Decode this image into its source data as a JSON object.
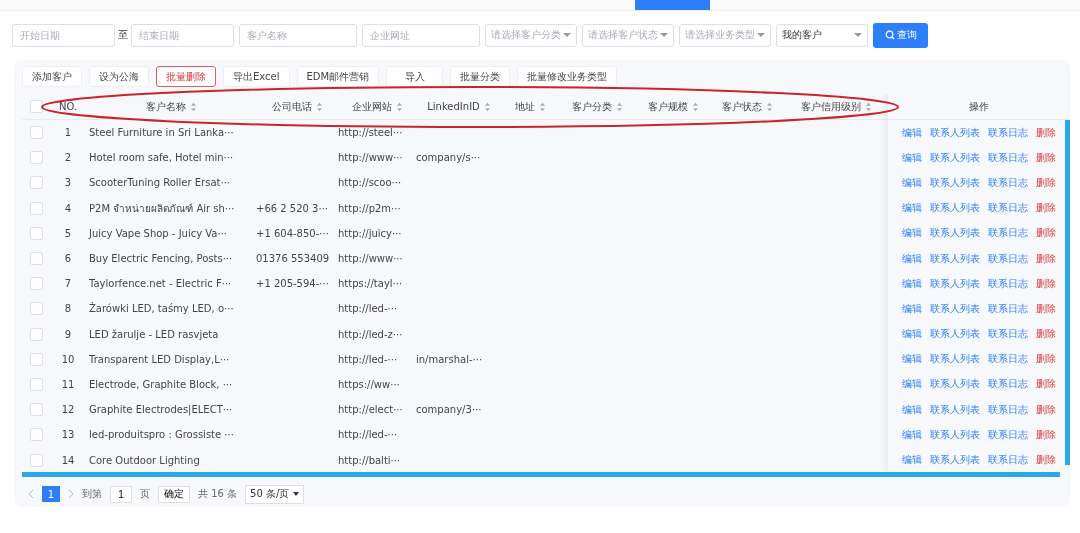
{
  "filters": {
    "start_date": {
      "placeholder": "开始日期"
    },
    "to_label": "至",
    "end_date": {
      "placeholder": "结束日期"
    },
    "customer_name": {
      "placeholder": "客户名称"
    },
    "website": {
      "placeholder": "企业网址"
    },
    "selects": [
      {
        "placeholder": "请选择客户分类"
      },
      {
        "placeholder": "请选择客户状态"
      },
      {
        "placeholder": "请选择业务类型"
      },
      {
        "value": "我的客户"
      }
    ],
    "search_button": "查询"
  },
  "toolbar": [
    {
      "label": "添加客户",
      "kind": "normal"
    },
    {
      "label": "设为公海",
      "kind": "normal"
    },
    {
      "label": "批量删除",
      "kind": "danger"
    },
    {
      "label": "导出Excel",
      "kind": "normal"
    },
    {
      "label": "EDM邮件营销",
      "kind": "normal"
    },
    {
      "label": "导入",
      "kind": "normal"
    },
    {
      "label": "批量分类",
      "kind": "normal"
    },
    {
      "label": "批量修改业务类型",
      "kind": "normal"
    }
  ],
  "table": {
    "all_checked": false,
    "columns": [
      {
        "label": "NO.",
        "sortable": false
      },
      {
        "label": "客户名称",
        "sortable": true
      },
      {
        "label": "公司电话",
        "sortable": true
      },
      {
        "label": "企业网站",
        "sortable": true
      },
      {
        "label": "LinkedInID",
        "sortable": true
      },
      {
        "label": "地址",
        "sortable": true
      },
      {
        "label": "客户分类",
        "sortable": true
      },
      {
        "label": "客户规模",
        "sortable": true
      },
      {
        "label": "客户状态",
        "sortable": true
      },
      {
        "label": "客户信用级别",
        "sortable": true
      }
    ],
    "actions_header": "操作",
    "rows": [
      {
        "checked": false,
        "no": "1",
        "name": "Steel Furniture in Sri Lanka···",
        "phone": "",
        "website": "http://steel···",
        "linkedin": "",
        "actions": [
          {
            "label": "编辑",
            "kind": "link"
          },
          {
            "label": "联系人列表",
            "kind": "link"
          },
          {
            "label": "联系日志",
            "kind": "link"
          },
          {
            "label": "删除",
            "kind": "danger"
          }
        ]
      },
      {
        "checked": false,
        "no": "2",
        "name": "Hotel room safe, Hotel min···",
        "phone": "",
        "website": "http://www···",
        "linkedin": "company/s···",
        "actions": [
          {
            "label": "编辑",
            "kind": "link"
          },
          {
            "label": "联系人列表",
            "kind": "link"
          },
          {
            "label": "联系日志",
            "kind": "link"
          },
          {
            "label": "删除",
            "kind": "danger"
          }
        ]
      },
      {
        "checked": false,
        "no": "3",
        "name": "ScooterTuning Roller Ersat···",
        "phone": "",
        "website": "http://scoo···",
        "linkedin": "",
        "actions": [
          {
            "label": "编辑",
            "kind": "link"
          },
          {
            "label": "联系人列表",
            "kind": "link"
          },
          {
            "label": "联系日志",
            "kind": "link"
          },
          {
            "label": "删除",
            "kind": "danger"
          }
        ]
      },
      {
        "checked": false,
        "no": "4",
        "name": "P2M จำหน่ายผลิตภัณฑ์ Air sh···",
        "phone": "+66 2 520 3···",
        "website": "http://p2m···",
        "linkedin": "",
        "actions": [
          {
            "label": "编辑",
            "kind": "link"
          },
          {
            "label": "联系人列表",
            "kind": "link"
          },
          {
            "label": "联系日志",
            "kind": "link"
          },
          {
            "label": "删除",
            "kind": "danger"
          }
        ]
      },
      {
        "checked": false,
        "no": "5",
        "name": "Juicy Vape Shop - Juicy Va···",
        "phone": "+1 604-850-···",
        "website": "http://juicy···",
        "linkedin": "",
        "actions": [
          {
            "label": "编辑",
            "kind": "link"
          },
          {
            "label": "联系人列表",
            "kind": "link"
          },
          {
            "label": "联系日志",
            "kind": "link"
          },
          {
            "label": "删除",
            "kind": "danger"
          }
        ]
      },
      {
        "checked": false,
        "no": "6",
        "name": "Buy Electric Fencing, Posts···",
        "phone": "01376 553409",
        "website": "http://www···",
        "linkedin": "",
        "actions": [
          {
            "label": "编辑",
            "kind": "link"
          },
          {
            "label": "联系人列表",
            "kind": "link"
          },
          {
            "label": "联系日志",
            "kind": "link"
          },
          {
            "label": "删除",
            "kind": "danger"
          }
        ]
      },
      {
        "checked": false,
        "no": "7",
        "name": "Taylorfence.net - Electric F···",
        "phone": "+1 205-594-···",
        "website": "https://tayl···",
        "linkedin": "",
        "actions": [
          {
            "label": "编辑",
            "kind": "link"
          },
          {
            "label": "联系人列表",
            "kind": "link"
          },
          {
            "label": "联系日志",
            "kind": "link"
          },
          {
            "label": "删除",
            "kind": "danger"
          }
        ]
      },
      {
        "checked": false,
        "no": "8",
        "name": "Żarówki LED, taśmy LED, o···",
        "phone": "",
        "website": "http://led-···",
        "linkedin": "",
        "actions": [
          {
            "label": "编辑",
            "kind": "link"
          },
          {
            "label": "联系人列表",
            "kind": "link"
          },
          {
            "label": "联系日志",
            "kind": "link"
          },
          {
            "label": "删除",
            "kind": "danger"
          }
        ]
      },
      {
        "checked": false,
        "no": "9",
        "name": "LED žarulje - LED rasvjeta",
        "phone": "",
        "website": "http://led-z···",
        "linkedin": "",
        "actions": [
          {
            "label": "编辑",
            "kind": "link"
          },
          {
            "label": "联系人列表",
            "kind": "link"
          },
          {
            "label": "联系日志",
            "kind": "link"
          },
          {
            "label": "删除",
            "kind": "danger"
          }
        ]
      },
      {
        "checked": false,
        "no": "10",
        "name": "Transparent LED Display,L···",
        "phone": "",
        "website": "http://led-···",
        "linkedin": "in/marshal-···",
        "actions": [
          {
            "label": "编辑",
            "kind": "link"
          },
          {
            "label": "联系人列表",
            "kind": "link"
          },
          {
            "label": "联系日志",
            "kind": "link"
          },
          {
            "label": "删除",
            "kind": "danger"
          }
        ]
      },
      {
        "checked": false,
        "no": "11",
        "name": "Electrode, Graphite Block, ···",
        "phone": "",
        "website": "https://ww···",
        "linkedin": "",
        "actions": [
          {
            "label": "编辑",
            "kind": "link"
          },
          {
            "label": "联系人列表",
            "kind": "link"
          },
          {
            "label": "联系日志",
            "kind": "link"
          },
          {
            "label": "删除",
            "kind": "danger"
          }
        ]
      },
      {
        "checked": false,
        "no": "12",
        "name": "Graphite Electrodes|ELECT···",
        "phone": "",
        "website": "http://elect···",
        "linkedin": "company/3···",
        "actions": [
          {
            "label": "编辑",
            "kind": "link"
          },
          {
            "label": "联系人列表",
            "kind": "link"
          },
          {
            "label": "联系日志",
            "kind": "link"
          },
          {
            "label": "删除",
            "kind": "danger"
          }
        ]
      },
      {
        "checked": false,
        "no": "13",
        "name": "led-produitspro : Grossiste ···",
        "phone": "",
        "website": "http://led-···",
        "linkedin": "",
        "actions": [
          {
            "label": "编辑",
            "kind": "link"
          },
          {
            "label": "联系人列表",
            "kind": "link"
          },
          {
            "label": "联系日志",
            "kind": "link"
          },
          {
            "label": "删除",
            "kind": "danger"
          }
        ]
      },
      {
        "checked": false,
        "no": "14",
        "name": "Core Outdoor Lighting",
        "phone": "",
        "website": "http://balti···",
        "linkedin": "",
        "actions": [
          {
            "label": "编辑",
            "kind": "link"
          },
          {
            "label": "联系人列表",
            "kind": "link"
          },
          {
            "label": "联系日志",
            "kind": "link"
          },
          {
            "label": "删除",
            "kind": "danger"
          }
        ]
      }
    ]
  },
  "pagination": {
    "pages": [
      {
        "label": "1",
        "selected": true
      }
    ],
    "goto_label": "到第",
    "goto_value": "1",
    "page_unit": "页",
    "confirm": "确定",
    "total": "共 16 条",
    "page_size": "50 条/页"
  }
}
